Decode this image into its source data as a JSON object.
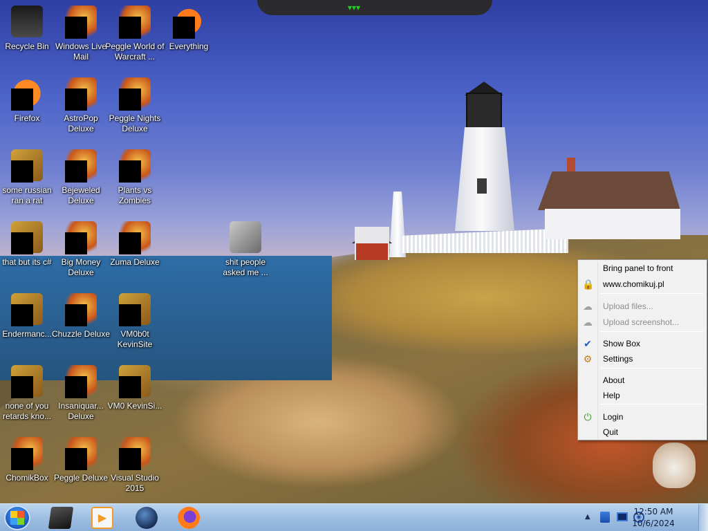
{
  "desktop": {
    "icons": [
      {
        "label": "Recycle Bin",
        "icon": "recycle-bin-icon"
      },
      {
        "label": "Windows Live Mail",
        "icon": "windows-live-mail-icon"
      },
      {
        "label": "Peggle World of Warcraft ...",
        "icon": "peggle-wow-icon"
      },
      {
        "label": "Everything",
        "icon": "everything-icon"
      },
      {
        "label": "Firefox",
        "icon": "firefox-icon"
      },
      {
        "label": "AstroPop Deluxe",
        "icon": "astropop-icon"
      },
      {
        "label": "Peggle Nights Deluxe",
        "icon": "peggle-nights-icon"
      },
      {
        "label": "some russian ran a rat",
        "icon": "app-icon"
      },
      {
        "label": "Bejeweled Deluxe",
        "icon": "bejeweled-icon"
      },
      {
        "label": "Plants vs Zombies",
        "icon": "plants-vs-zombies-icon"
      },
      {
        "label": "that but its c#",
        "icon": "app-icon"
      },
      {
        "label": "Big Money Deluxe",
        "icon": "big-money-icon"
      },
      {
        "label": "Zuma Deluxe",
        "icon": "zuma-icon"
      },
      {
        "label": "shit people asked me ...",
        "icon": "folder-icon"
      },
      {
        "label": "Endermanc...",
        "icon": "app-icon"
      },
      {
        "label": "Chuzzle Deluxe",
        "icon": "chuzzle-icon"
      },
      {
        "label": "VM0b0t KevinSite",
        "icon": "app-icon"
      },
      {
        "label": "none of you retards kno...",
        "icon": "app-icon"
      },
      {
        "label": "Insaniquar... Deluxe",
        "icon": "insaniquarium-icon"
      },
      {
        "label": "VM0 KevinSi...",
        "icon": "app-icon"
      },
      {
        "label": "ChomikBox",
        "icon": "chomikbox-icon"
      },
      {
        "label": "Peggle Deluxe",
        "icon": "peggle-icon"
      },
      {
        "label": "Visual Studio 2015",
        "icon": "visual-studio-icon"
      }
    ]
  },
  "context_menu": {
    "items": [
      {
        "label": "Bring panel to front",
        "enabled": true,
        "icon": ""
      },
      {
        "label": "www.chomikuj.pl",
        "enabled": true,
        "icon": "lock-icon"
      },
      {
        "label": "Upload files...",
        "enabled": false,
        "icon": "cloud-upload-icon"
      },
      {
        "label": "Upload screenshot...",
        "enabled": false,
        "icon": "cloud-upload-icon"
      },
      {
        "label": "Show Box",
        "enabled": true,
        "icon": "check-icon",
        "checked": true
      },
      {
        "label": "Settings",
        "enabled": true,
        "icon": "gear-icon"
      },
      {
        "label": "About",
        "enabled": true,
        "icon": ""
      },
      {
        "label": "Help",
        "enabled": true,
        "icon": ""
      },
      {
        "label": "Login",
        "enabled": true,
        "icon": "login-icon"
      },
      {
        "label": "Quit",
        "enabled": true,
        "icon": ""
      }
    ]
  },
  "taskbar": {
    "pinned": [
      {
        "name": "media-center-icon"
      },
      {
        "name": "media-player-icon"
      },
      {
        "name": "globe-icon"
      },
      {
        "name": "firefox-icon"
      }
    ],
    "clock": {
      "time": "12:50 AM",
      "date": "10/6/2024"
    }
  },
  "colors": {
    "taskbar": "#9fbfe2",
    "menu_bg": "#f1f1f1",
    "disabled_text": "#8d8d8d",
    "accent_check": "#1c5cc4"
  }
}
